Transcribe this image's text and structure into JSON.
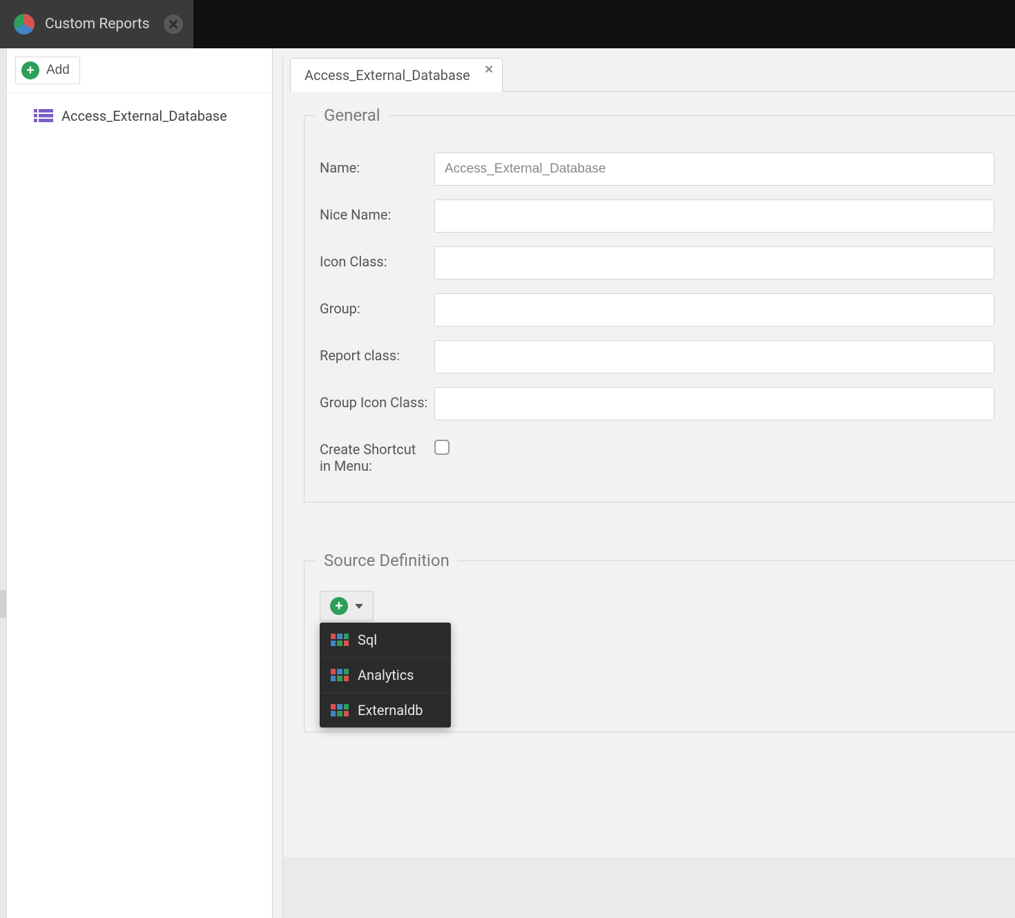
{
  "header": {
    "tab_title": "Custom Reports"
  },
  "sidebar": {
    "add_label": "Add",
    "items": [
      {
        "label": "Access_External_Database"
      }
    ]
  },
  "content": {
    "tab": {
      "label": "Access_External_Database"
    },
    "general": {
      "legend": "General",
      "fields": {
        "name": {
          "label": "Name:",
          "value": "Access_External_Database"
        },
        "nice_name": {
          "label": "Nice Name:",
          "value": ""
        },
        "icon_class": {
          "label": "Icon Class:",
          "value": ""
        },
        "group": {
          "label": "Group:",
          "value": ""
        },
        "report_class": {
          "label": "Report class:",
          "value": ""
        },
        "group_icon_class": {
          "label": "Group Icon Class:",
          "value": ""
        },
        "create_shortcut": {
          "label": "Create Shortcut in Menu:",
          "checked": false
        }
      }
    },
    "source_definition": {
      "legend": "Source Definition",
      "menu": [
        {
          "label": "Sql"
        },
        {
          "label": "Analytics"
        },
        {
          "label": "Externaldb"
        }
      ]
    }
  }
}
